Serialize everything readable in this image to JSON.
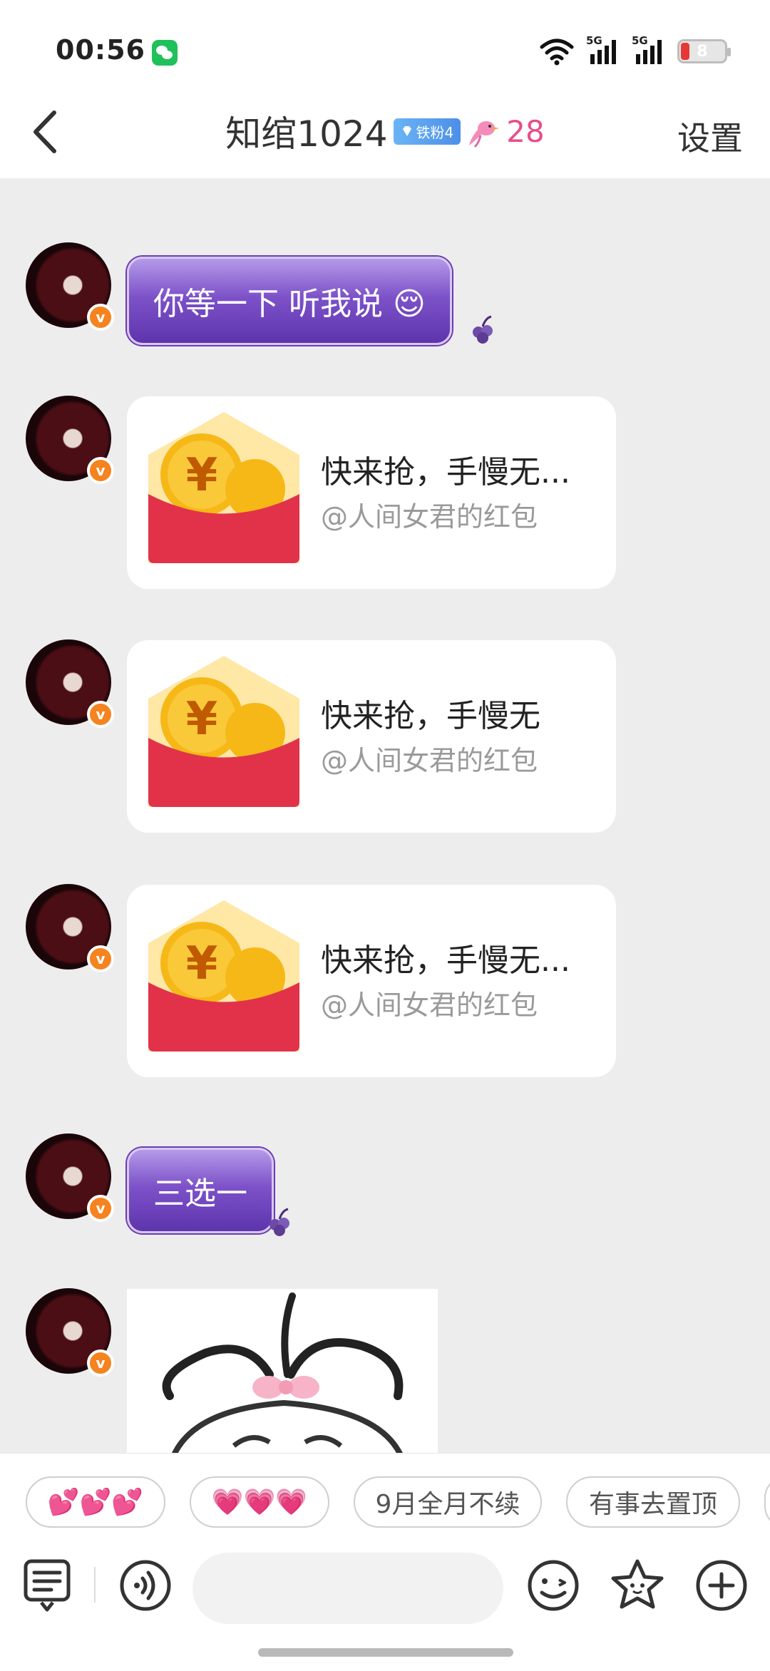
{
  "status_bar": {
    "time": "00:56",
    "network_1": "5G",
    "network_2": "5G",
    "battery": "8"
  },
  "header": {
    "title": "知绾1024",
    "fan_badge": "铁粉4",
    "heat": "28",
    "settings": "设置"
  },
  "messages": [
    {
      "type": "text",
      "text": "你等一下 听我说 😌"
    },
    {
      "type": "red_packet",
      "title": "快来抢，手慢无...",
      "sub": "@人间女君的红包"
    },
    {
      "type": "red_packet",
      "title": "快来抢，手慢无",
      "sub": "@人间女君的红包"
    },
    {
      "type": "red_packet",
      "title": "快来抢，手慢无...",
      "sub": "@人间女君的红包"
    },
    {
      "type": "text",
      "text": "三选一"
    },
    {
      "type": "sticker"
    }
  ],
  "quick_replies": [
    "💕💕💕",
    "💗💗💗",
    "9月全月不续",
    "有事去置顶"
  ],
  "avatar_badge": "v"
}
